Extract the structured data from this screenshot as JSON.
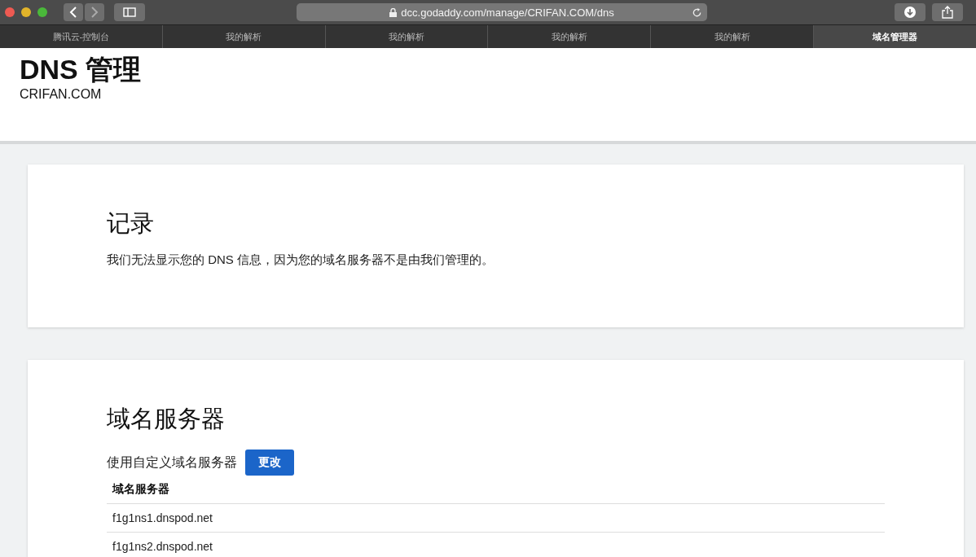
{
  "browser": {
    "url": "dcc.godaddy.com/manage/CRIFAN.COM/dns"
  },
  "tabs": [
    {
      "label": "腾讯云-控制台",
      "selected": false
    },
    {
      "label": "我的解析",
      "selected": false
    },
    {
      "label": "我的解析",
      "selected": false
    },
    {
      "label": "我的解析",
      "selected": false
    },
    {
      "label": "我的解析",
      "selected": false
    },
    {
      "label": "域名管理器",
      "selected": true
    }
  ],
  "header": {
    "title": "DNS 管理",
    "domain": "CRIFAN.COM"
  },
  "records": {
    "title": "记录",
    "message": "我们无法显示您的 DNS 信息，因为您的域名服务器不是由我们管理的。"
  },
  "nameservers": {
    "title": "域名服务器",
    "status": "使用自定义域名服务器",
    "change_button": "更改",
    "column": "域名服务器",
    "rows": [
      "f1g1ns1.dnspod.net",
      "f1g1ns2.dnspod.net"
    ]
  }
}
